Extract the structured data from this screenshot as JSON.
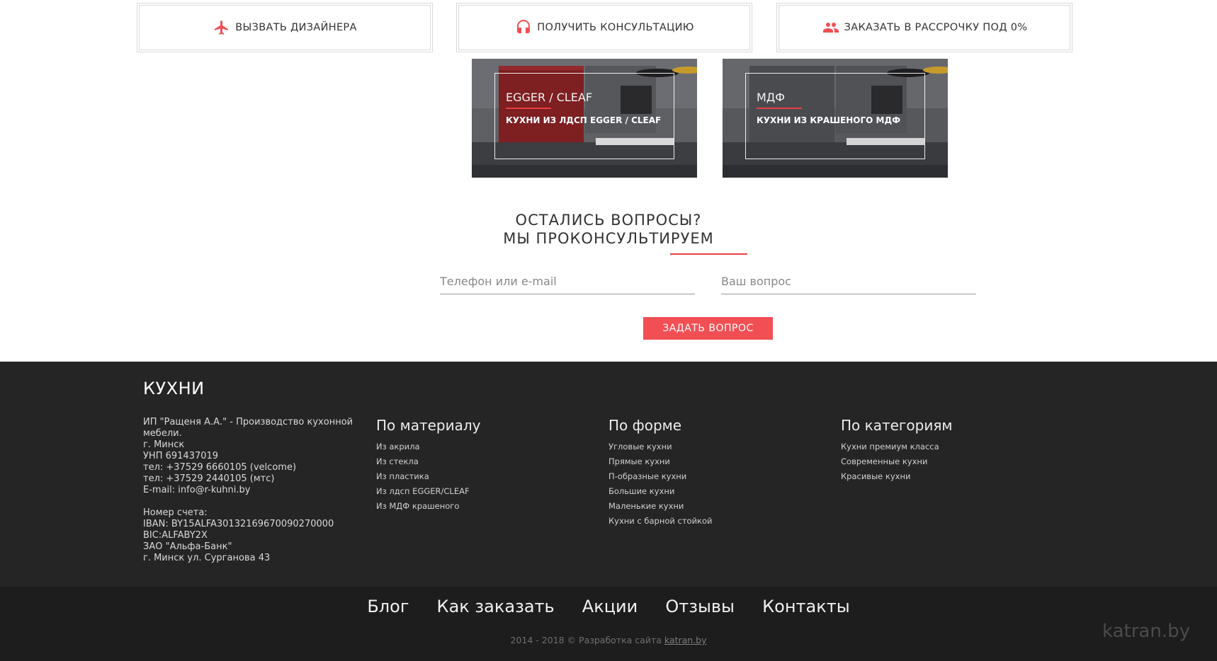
{
  "actions": [
    {
      "label": "Вызвать дизайнера",
      "icon": "airplane-icon"
    },
    {
      "label": "Получить консультацию",
      "icon": "headphones-icon"
    },
    {
      "label": "Заказать в рассрочку под 0%",
      "icon": "group-icon"
    }
  ],
  "cards": [
    {
      "title": "EGGER / CLEAF",
      "subtitle": "Кухни из ЛДСП EGGER / CLEAF"
    },
    {
      "title": "МДФ",
      "subtitle": "Кухни из крашеного МДФ"
    }
  ],
  "question": {
    "title_line1": "Остались вопросы?",
    "title_line2": "Мы проконсультируем",
    "contact_placeholder": "Телефон или e-mail",
    "question_placeholder": "Ваш вопрос",
    "submit_label": "Задать вопрос"
  },
  "footer": {
    "brand": "Кухни",
    "about": "ИП \"Ращеня А.А.\" - Производство кухонной мебели.\nг. Минск\nУНП 691437019\nтел: +37529 6660105 (velcome)\nтел: +37529 2440105 (мтс)\nE-mail: info@r-kuhni.by\n\nНомер счета:\nIBAN: BY15ALFA30132169670090270000\nBIC:ALFABY2X\nЗАО \"Альфа-Банк\"\nг. Минск ул. Сурганова 43",
    "columns": [
      {
        "title": "По материалу",
        "links": [
          "Из акрила",
          "Из стекла",
          "Из пластика",
          "Из лдсп EGGER/CLEAF",
          "Из МДФ крашеного"
        ]
      },
      {
        "title": "По форме",
        "links": [
          "Угловые кухни",
          "Прямые кухни",
          "П-образные кухни",
          "Большие кухни",
          "Маленькие кухни",
          "Кухни с барной стойкой"
        ]
      },
      {
        "title": "По категориям",
        "links": [
          "Кухни премиум класса",
          "Современные кухни",
          "Красивые кухни"
        ]
      }
    ],
    "nav": [
      "Блог",
      "Как заказать",
      "Акции",
      "Отзывы",
      "Контакты"
    ],
    "copyright_text": "2014 - 2018 © Разработка сайта",
    "copyright_link": "katran.by",
    "dev_logo": "katran.by"
  },
  "colors": {
    "accent": "#f24f55",
    "footer_bg": "#252525",
    "bottom_bg": "#1d1d1d"
  }
}
